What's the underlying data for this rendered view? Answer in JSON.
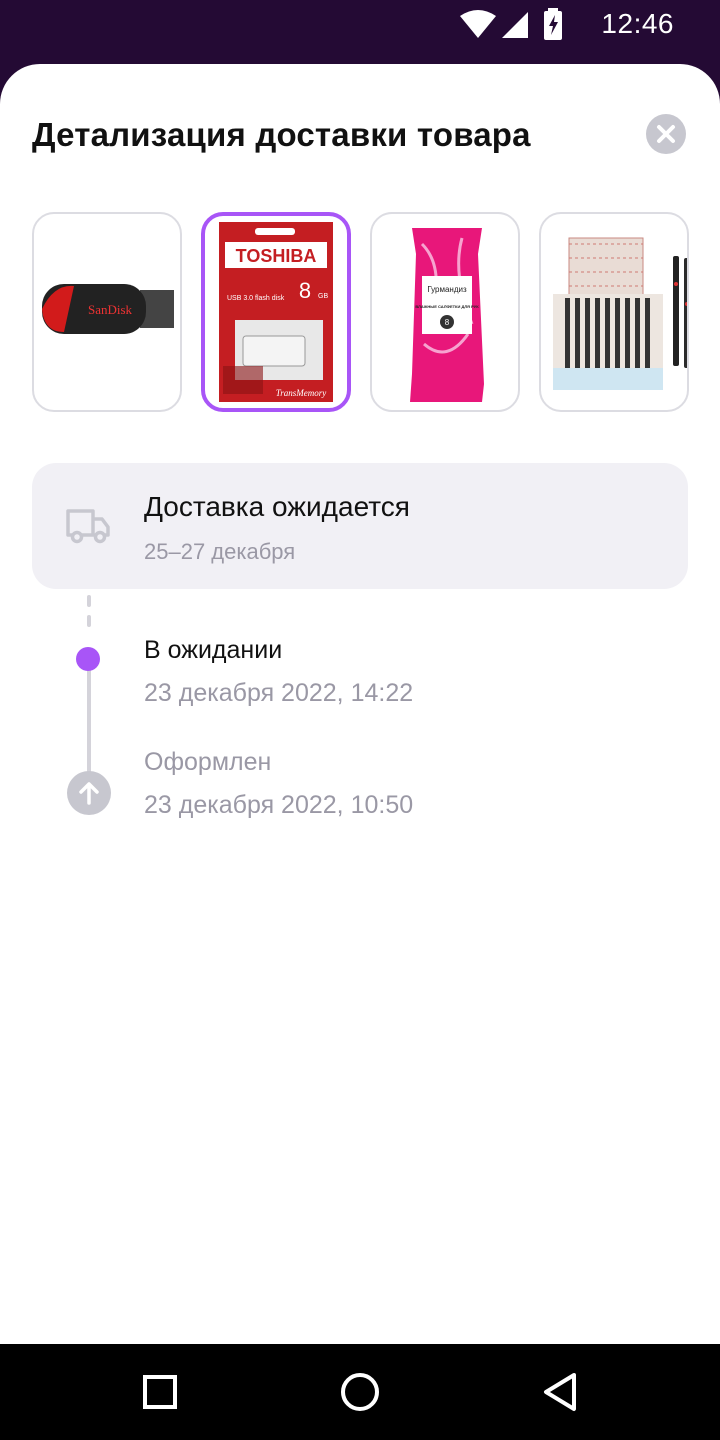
{
  "status_bar": {
    "time": "12:46",
    "icons": [
      "wifi-icon",
      "signal-icon",
      "battery-charging-icon"
    ]
  },
  "sheet": {
    "title": "Детализация доставки товара",
    "close_icon": "close-icon"
  },
  "products": [
    {
      "name": "usb-flash-drive",
      "selected": false,
      "brand_text": "SanDisk"
    },
    {
      "name": "usb-flash-drive-package",
      "selected": true,
      "brand_text": "TOSHIBA",
      "capacity": "8",
      "unit": "GB",
      "subtitle": "USB 3.0 flash disk",
      "product_line": "TransMemory"
    },
    {
      "name": "wet-wipes-pack",
      "selected": false,
      "brand_text": "Гурмандиз",
      "caption": "ВЛАЖНЫЕ САЛФЕТКИ ДЛЯ РУК",
      "count": "8"
    },
    {
      "name": "pens-display-box",
      "selected": false
    }
  ],
  "delivery": {
    "title": "Доставка ожидается",
    "dates": "25–27 декабря",
    "icon": "truck-icon"
  },
  "timeline": [
    {
      "status": "В ожидании",
      "datetime": "23 декабря 2022, 14:22",
      "state": "current"
    },
    {
      "status": "Оформлен",
      "datetime": "23 декабря 2022, 10:50",
      "state": "done"
    }
  ],
  "colors": {
    "accent": "#a855f7",
    "status_bar_bg": "#240a34",
    "card_bg": "#f1f0f5",
    "muted_text": "#9a98a5",
    "icon_grey": "#c7c7cf"
  },
  "nav": [
    "recents-square-icon",
    "home-circle-icon",
    "back-triangle-icon"
  ]
}
